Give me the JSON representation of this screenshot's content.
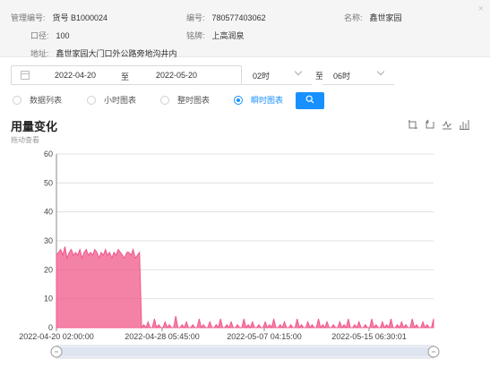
{
  "info": {
    "mgmt_no_label": "管理编号:",
    "mgmt_no_value": "货号 B1000024",
    "serial_label": "编号:",
    "serial_value": "780577403062",
    "name_label": "名称:",
    "name_value": "鑫世家园",
    "caliber_label": "口径:",
    "caliber_value": "100",
    "brand_label": "铭牌:",
    "brand_value": "上高润泉",
    "address_label": "地址:",
    "address_value": "鑫世家园大门口外公路旁地沟井内",
    "close_icon": "×"
  },
  "filter": {
    "start_date": "2022-04-20",
    "to_label": "至",
    "end_date": "2022-05-20",
    "start_hour": "02时",
    "end_hour": "06时",
    "hour_to_label": "至"
  },
  "modes": [
    {
      "label": "数据列表",
      "checked": false
    },
    {
      "label": "小时图表",
      "checked": false
    },
    {
      "label": "整时图表",
      "checked": false
    },
    {
      "label": "瞬时图表",
      "checked": true
    }
  ],
  "search_button_icon": "search-icon",
  "chart_header": {
    "title": "用量变化",
    "subtitle": "拖动查看"
  },
  "toolbox": [
    "zoom-icon",
    "zoom-reset-icon",
    "line-chart-icon",
    "bar-chart-icon"
  ],
  "chart_data": {
    "type": "area",
    "title": "用量变化",
    "xlabel": "",
    "ylabel": "",
    "ylim": [
      0,
      60
    ],
    "yticks": [
      0,
      10,
      20,
      30,
      40,
      50,
      60
    ],
    "xticks": [
      "2022-04-20 02:00:00",
      "2022-04-28 05:45:00",
      "2022-05-07 04:15:00",
      "2022-05-15 06:30:01"
    ],
    "x_range": [
      "2022-04-20",
      "2022-05-20"
    ],
    "grid": true,
    "color": "#f0588a",
    "series": [
      {
        "values": [
          25,
          26,
          27,
          25,
          28,
          24,
          26,
          27,
          25,
          26,
          25,
          27,
          24,
          26,
          27,
          25,
          26,
          25,
          27,
          26,
          24,
          26,
          25,
          27,
          25,
          26,
          24,
          26,
          25,
          27,
          26,
          25,
          24,
          26,
          26,
          25,
          27,
          24,
          25,
          26,
          0,
          1,
          0,
          2,
          0,
          0,
          3,
          0,
          1,
          0,
          0,
          2,
          0,
          1,
          0,
          0,
          4,
          0,
          0,
          1,
          0,
          2,
          0,
          0,
          1,
          0,
          0,
          3,
          0,
          1,
          0,
          0,
          2,
          0,
          0,
          1,
          0,
          3,
          0,
          0,
          1,
          0,
          2,
          0,
          0,
          1,
          0,
          0,
          3,
          0,
          1,
          0,
          2,
          0,
          0,
          1,
          0,
          0,
          2,
          0,
          1,
          0,
          3,
          0,
          0,
          1,
          0,
          2,
          0,
          0,
          1,
          0,
          0,
          3,
          0,
          1,
          0,
          0,
          2,
          0,
          1,
          0,
          0,
          3,
          0,
          1,
          0,
          2,
          0,
          0,
          1,
          0,
          0,
          2,
          0,
          1,
          0,
          3,
          0,
          0,
          1,
          0,
          2,
          0,
          0,
          1,
          0,
          0,
          3,
          0,
          1,
          0,
          0,
          2,
          0,
          1,
          0,
          3,
          0,
          0,
          1,
          0,
          2,
          0,
          1,
          0,
          0,
          3,
          0,
          1,
          0,
          0,
          2,
          0,
          1,
          0,
          0,
          3
        ]
      }
    ],
    "slider": {
      "start": 0,
      "end": 100
    }
  }
}
